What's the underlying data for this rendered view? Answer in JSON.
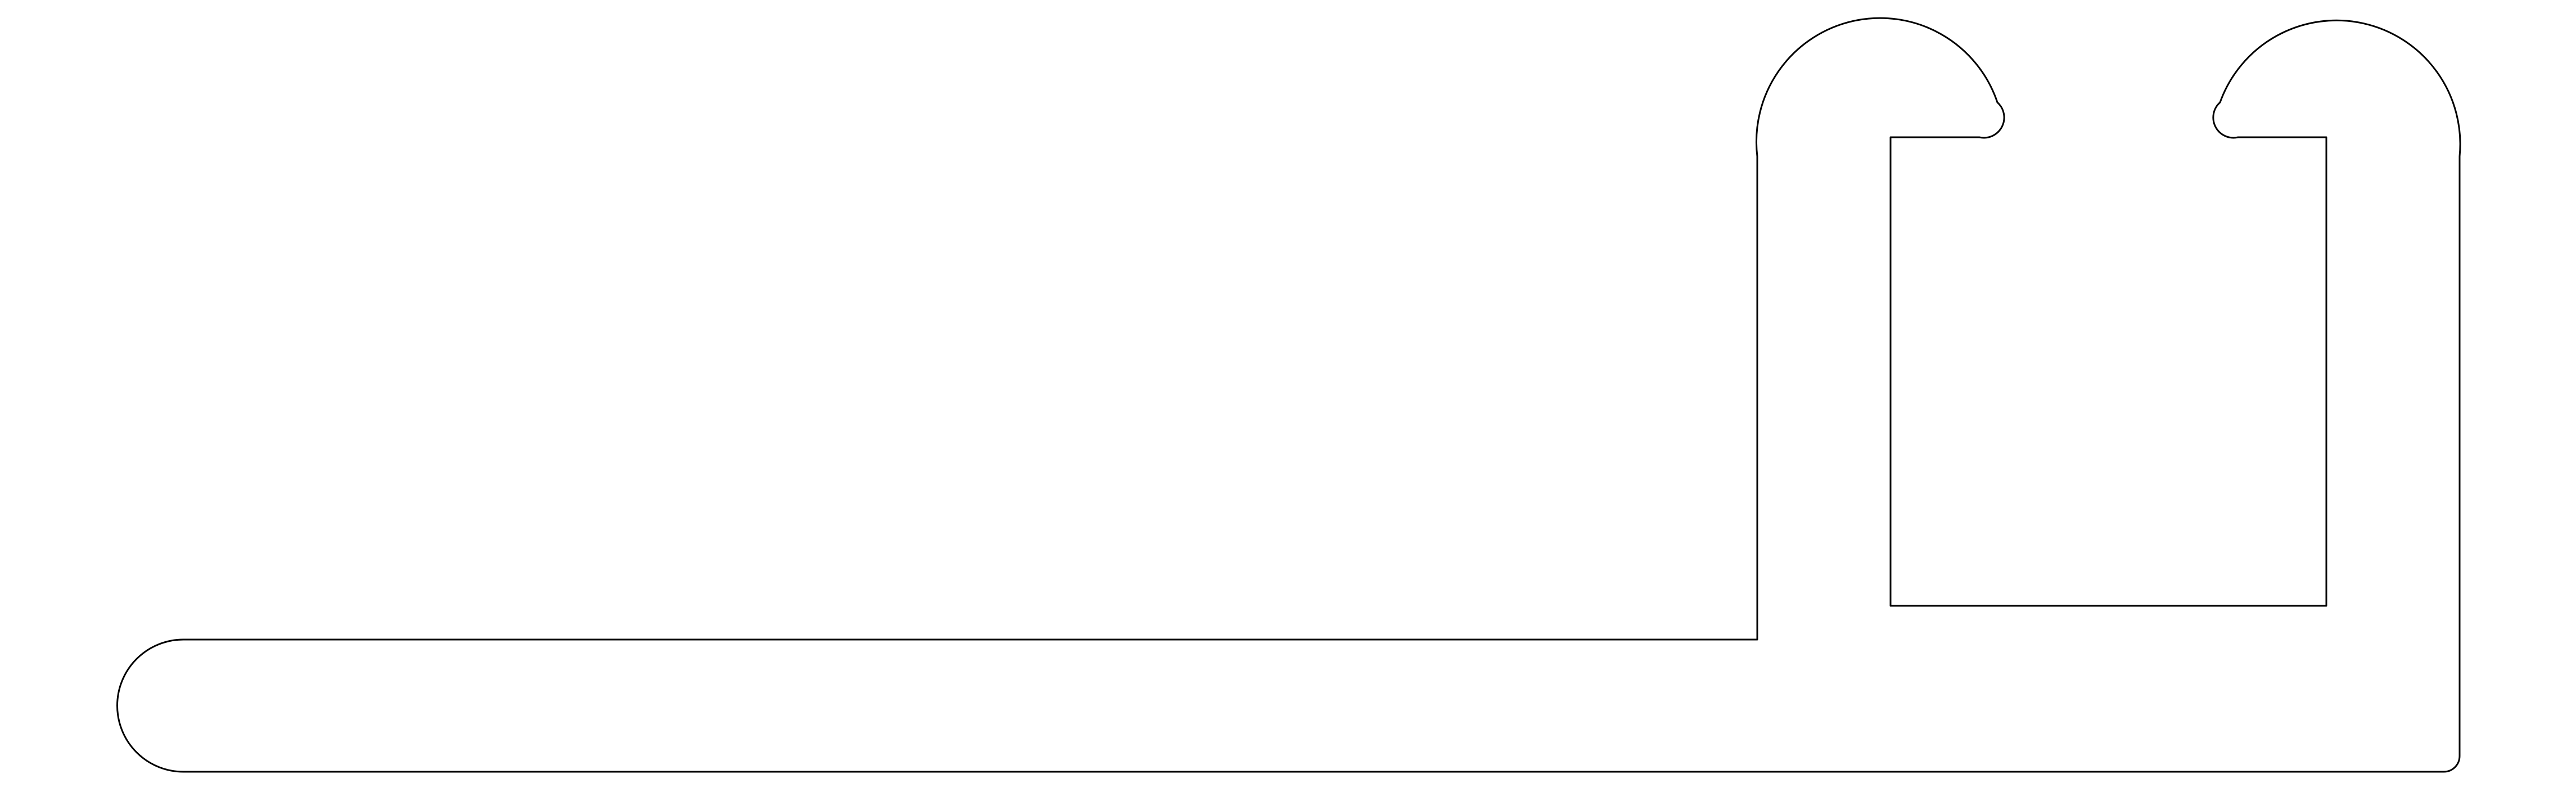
{
  "drawing": {
    "stroke_color": "#000000",
    "background_color": "#ffffff",
    "fill": "none"
  }
}
